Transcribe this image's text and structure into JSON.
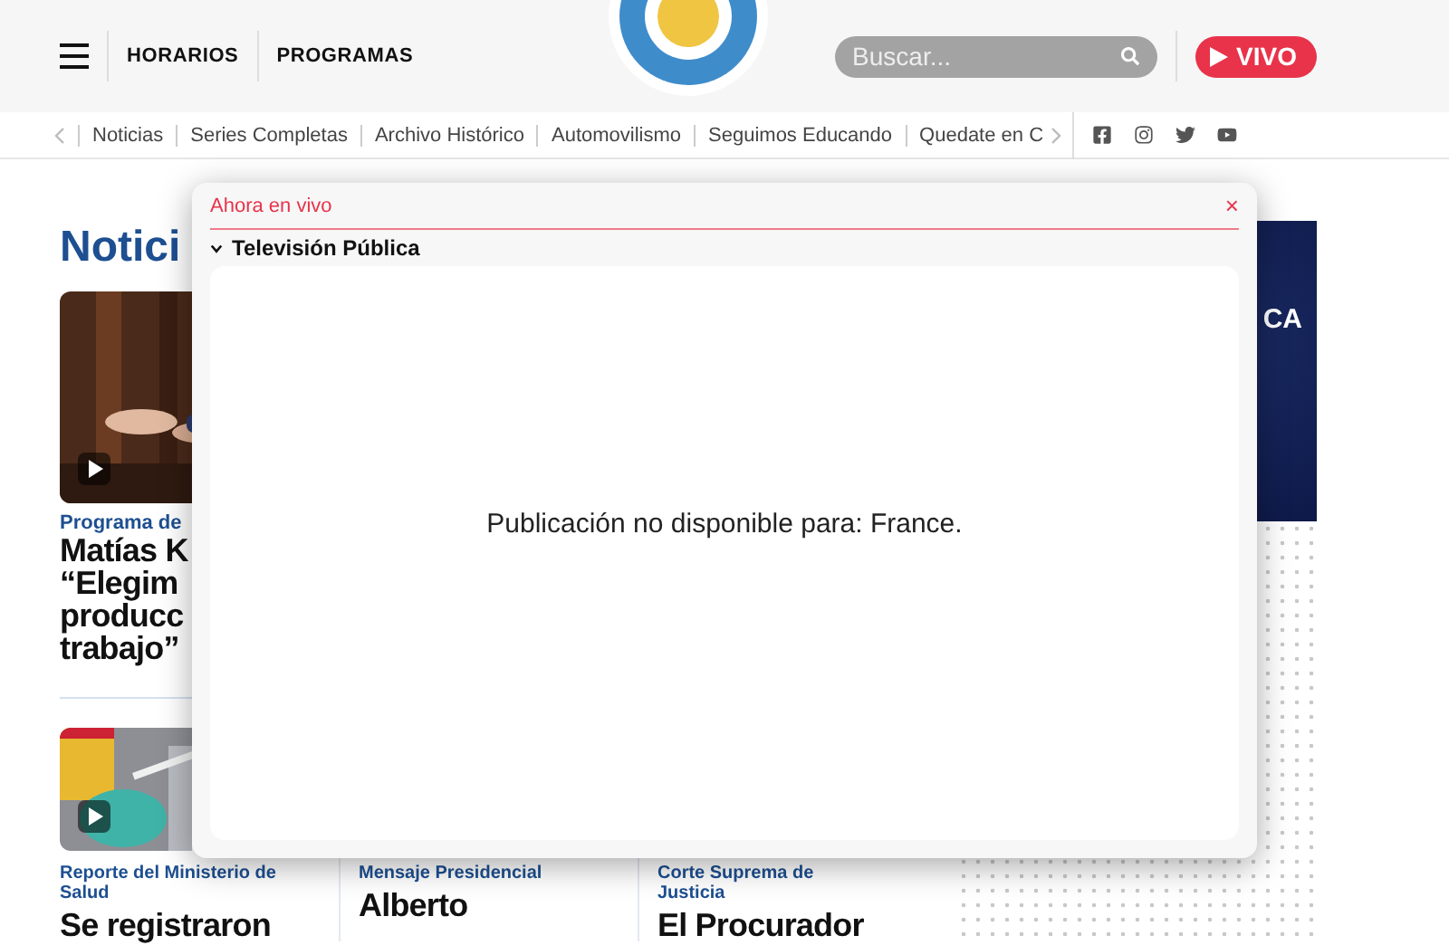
{
  "header": {
    "nav_links": [
      "HORARIOS",
      "PROGRAMAS"
    ],
    "search": {
      "placeholder": "Buscar..."
    },
    "live_button": "VIVO"
  },
  "subnav": {
    "items": [
      "Noticias",
      "Series Completas",
      "Archivo Histórico",
      "Automovilismo",
      "Seguimos Educando",
      "Quedate en C"
    ]
  },
  "content": {
    "section_title": "Notici",
    "featured": {
      "category": "Programa de",
      "title_lines": [
        "Matías K",
        "“Elegim",
        "producc",
        "trabajo”"
      ]
    },
    "cards": [
      {
        "category": "Reporte del Ministerio de Salud",
        "title_lines": [
          "Se registraron"
        ]
      },
      {
        "category": "Mensaje Presidencial",
        "title_lines": [
          "Alberto"
        ]
      },
      {
        "category": "Corte Suprema de Justicia",
        "title_lines": [
          "El Procurador"
        ]
      }
    ],
    "side_panel": {
      "text": "CA"
    }
  },
  "modal": {
    "title": "Ahora en vivo",
    "close": "×",
    "channel": {
      "name": "Televisión Pública",
      "expanded": true
    },
    "message": "Publicación no disponible para: France."
  }
}
